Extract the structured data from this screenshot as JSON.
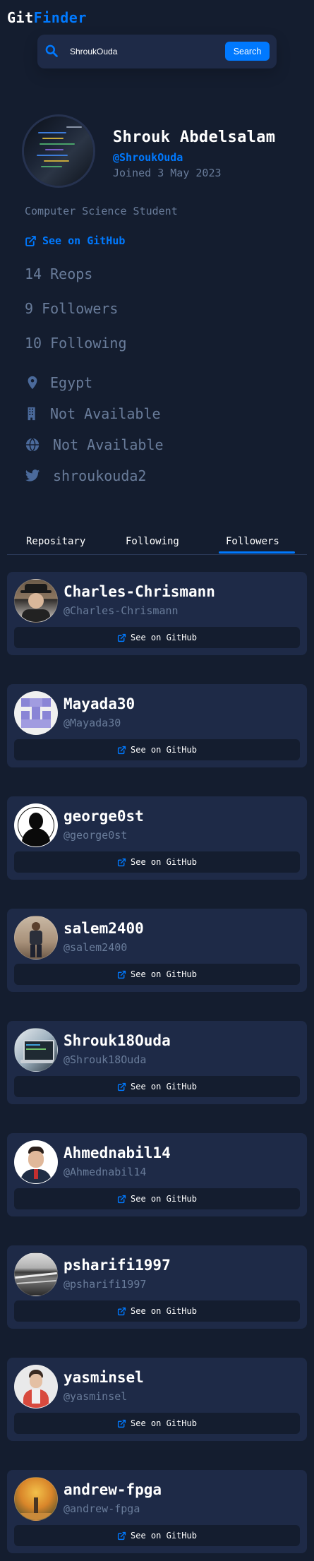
{
  "app": {
    "logo_part1": "Git",
    "logo_part2": "Finder"
  },
  "search": {
    "value": "ShroukOuda",
    "button_label": "Search"
  },
  "profile": {
    "name": "Shrouk Abdelsalam",
    "handle": "@ShroukOuda",
    "joined": "Joined 3 May 2023",
    "bio": "Computer Science Student",
    "github_link": "See on GitHub",
    "repos": "14 Reops",
    "followers": "9 Followers",
    "following": "10 Following",
    "location": "Egypt",
    "company": "Not Available",
    "website": "Not Available",
    "twitter": "shroukouda2"
  },
  "tabs": [
    {
      "label": "Repositary"
    },
    {
      "label": "Following"
    },
    {
      "label": "Followers",
      "active": true
    }
  ],
  "followers": [
    {
      "name": "Charles-Chrismann",
      "handle": "@Charles-Chrismann",
      "button": "See on GitHub",
      "avatar": "man-with-hat"
    },
    {
      "name": "Mayada30",
      "handle": "@Mayada30",
      "button": "See on GitHub",
      "avatar": "identicon-purple"
    },
    {
      "name": "george0st",
      "handle": "@george0st",
      "button": "See on GitHub",
      "avatar": "silhouette"
    },
    {
      "name": "salem2400",
      "handle": "@salem2400",
      "button": "See on GitHub",
      "avatar": "man-standing"
    },
    {
      "name": "Shrouk18Ouda",
      "handle": "@Shrouk18Ouda",
      "button": "See on GitHub",
      "avatar": "laptop-screen"
    },
    {
      "name": "Ahmednabil14",
      "handle": "@Ahmednabil14",
      "button": "See on GitHub",
      "avatar": "man-portrait"
    },
    {
      "name": "psharifi1997",
      "handle": "@psharifi1997",
      "button": "See on GitHub",
      "avatar": "grayscale-landscape"
    },
    {
      "name": "yasminsel",
      "handle": "@yasminsel",
      "button": "See on GitHub",
      "avatar": "woman-portrait"
    },
    {
      "name": "andrew-fpga",
      "handle": "@andrew-fpga",
      "button": "See on GitHub",
      "avatar": "autumn-tree"
    }
  ],
  "colors": {
    "background": "#141d2f",
    "card": "#1e2a47",
    "accent": "#0079ff",
    "muted": "#697c9a"
  }
}
